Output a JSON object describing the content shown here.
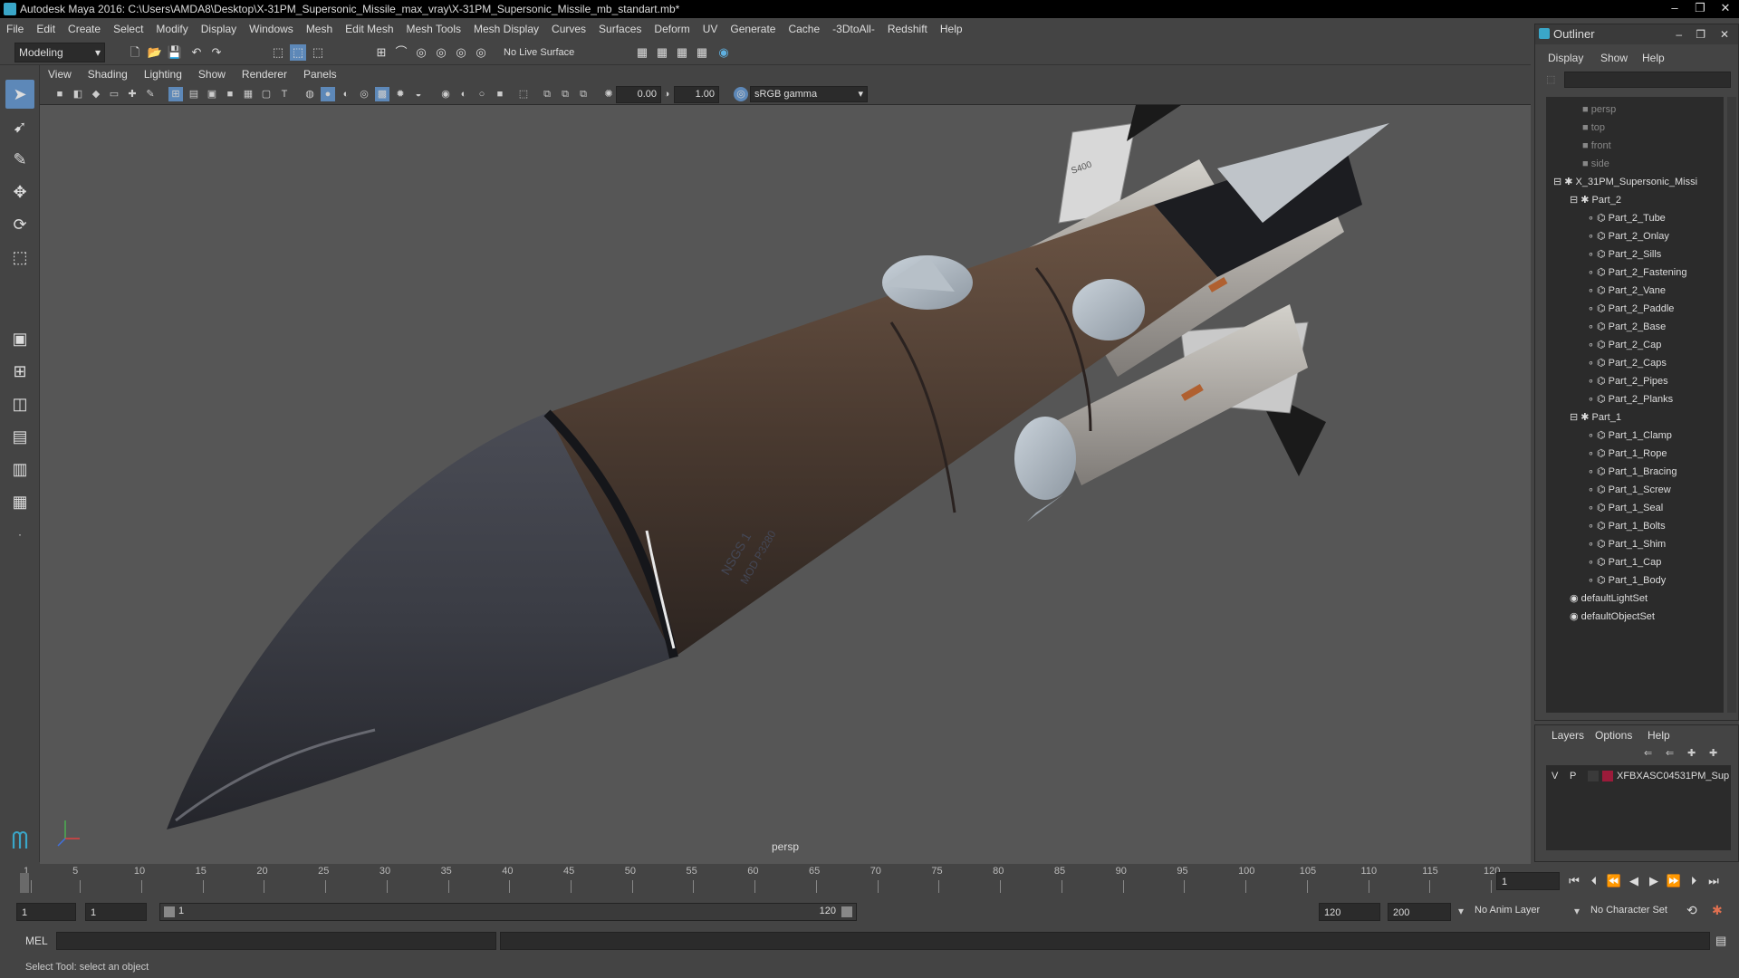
{
  "window": {
    "title": "Autodesk Maya 2016: C:\\Users\\AMDA8\\Desktop\\X-31PM_Supersonic_Missile_max_vray\\X-31PM_Supersonic_Missile_mb_standart.mb*"
  },
  "menubar": {
    "items": [
      "File",
      "Edit",
      "Create",
      "Select",
      "Modify",
      "Display",
      "Windows",
      "Mesh",
      "Edit Mesh",
      "Mesh Tools",
      "Mesh Display",
      "Curves",
      "Surfaces",
      "Deform",
      "UV",
      "Generate",
      "Cache",
      "-3DtoAll-",
      "Redshift",
      "Help"
    ]
  },
  "shelf": {
    "mode": "Modeling",
    "live_surface": "No Live Surface"
  },
  "viewport_menu": {
    "items": [
      "View",
      "Shading",
      "Lighting",
      "Show",
      "Renderer",
      "Panels"
    ]
  },
  "viewport_toolbar": {
    "exposure": "0.00",
    "gamma": "1.00",
    "color_space": "sRGB gamma"
  },
  "viewport": {
    "camera_label": "persp",
    "model_markings": [
      "S400",
      "NSGS 1",
      "MOD P3280"
    ]
  },
  "timeline": {
    "ticks": [
      "1",
      "5",
      "10",
      "15",
      "20",
      "25",
      "30",
      "35",
      "40",
      "45",
      "50",
      "55",
      "60",
      "65",
      "70",
      "75",
      "80",
      "85",
      "90",
      "95",
      "100",
      "105",
      "110",
      "115",
      "120"
    ],
    "current_frame": "1"
  },
  "range": {
    "start": "1",
    "playback_start": "1",
    "slider_start": "1",
    "slider_end": "120",
    "playback_end": "120",
    "end": "200",
    "anim_layer": "No Anim Layer",
    "character_set": "No Character Set"
  },
  "command": {
    "lang": "MEL"
  },
  "status": {
    "text": "Select Tool: select an object"
  },
  "outliner": {
    "title": "Outliner",
    "menu": [
      "Display",
      "Show",
      "Help"
    ],
    "cameras": [
      "persp",
      "top",
      "front",
      "side"
    ],
    "root": "X_31PM_Supersonic_Missi",
    "groups": [
      {
        "name": "Part_2",
        "children": [
          "Part_2_Tube",
          "Part_2_Onlay",
          "Part_2_Sills",
          "Part_2_Fastening",
          "Part_2_Vane",
          "Part_2_Paddle",
          "Part_2_Base",
          "Part_2_Cap",
          "Part_2_Caps",
          "Part_2_Pipes",
          "Part_2_Planks"
        ]
      },
      {
        "name": "Part_1",
        "children": [
          "Part_1_Clamp",
          "Part_1_Rope",
          "Part_1_Bracing",
          "Part_1_Screw",
          "Part_1_Seal",
          "Part_1_Bolts",
          "Part_1_Shim",
          "Part_1_Cap",
          "Part_1_Body"
        ]
      }
    ],
    "sets": [
      "defaultLightSet",
      "defaultObjectSet"
    ]
  },
  "layers": {
    "menu": [
      "Layers",
      "Options",
      "Help"
    ],
    "layer": {
      "v": "V",
      "p": "P",
      "name": "XFBXASC04531PM_Sup",
      "color": "#9b1b3a"
    }
  },
  "colors": {
    "active_blue": "#5d88b8",
    "panel": "#444444",
    "field": "#2b2b2b"
  }
}
